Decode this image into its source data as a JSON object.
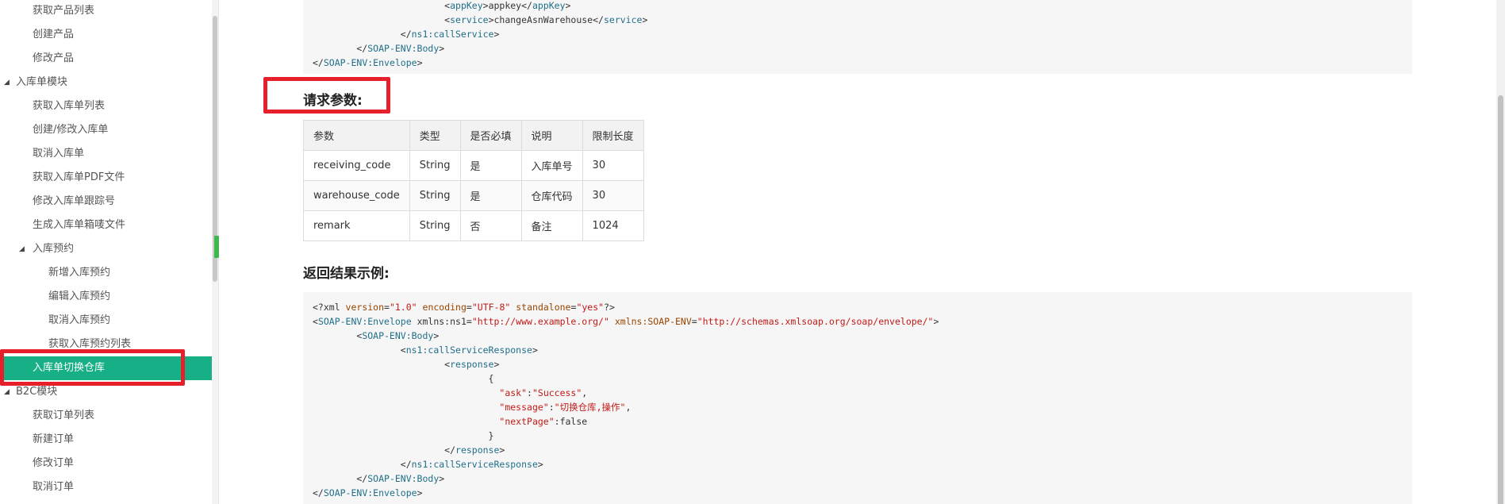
{
  "sidebar": {
    "items": [
      {
        "label": "获取产品列表",
        "level": 2
      },
      {
        "label": "创建产品",
        "level": 2
      },
      {
        "label": "修改产品",
        "level": 2
      },
      {
        "label": "入库单模块",
        "level": 1,
        "expanded": true
      },
      {
        "label": "获取入库单列表",
        "level": 2
      },
      {
        "label": "创建/修改入库单",
        "level": 2
      },
      {
        "label": "取消入库单",
        "level": 2
      },
      {
        "label": "获取入库单PDF文件",
        "level": 2
      },
      {
        "label": "修改入库单跟踪号",
        "level": 2
      },
      {
        "label": "生成入库单箱唛文件",
        "level": 2
      },
      {
        "label": "入库预约",
        "level": 2,
        "expanded": true
      },
      {
        "label": "新增入库预约",
        "level": 3
      },
      {
        "label": "编辑入库预约",
        "level": 3
      },
      {
        "label": "取消入库预约",
        "level": 3
      },
      {
        "label": "获取入库预约列表",
        "level": 3
      },
      {
        "label": "入库单切换仓库",
        "level": 2,
        "active": true
      },
      {
        "label": "B2C模块",
        "level": 1,
        "expanded": true
      },
      {
        "label": "获取订单列表",
        "level": 2
      },
      {
        "label": "新建订单",
        "level": 2
      },
      {
        "label": "修改订单",
        "level": 2
      },
      {
        "label": "取消订单",
        "level": 2
      }
    ],
    "collapse_icon": "chevron-left-icon"
  },
  "top_code": {
    "lines": [
      {
        "indent": 4,
        "text": "<appKey>appkey</appKey>"
      },
      {
        "indent": 4,
        "text": "<service>changeAsnWarehouse</service>"
      },
      {
        "indent": 3,
        "text": "</ns1:callService>"
      },
      {
        "indent": 2,
        "text": "</SOAP-ENV:Body>"
      },
      {
        "indent": 1,
        "text": "</SOAP-ENV:Envelope>"
      }
    ]
  },
  "request_params": {
    "title": "请求参数:",
    "headers": [
      "参数",
      "类型",
      "是否必填",
      "说明",
      "限制长度"
    ],
    "rows": [
      [
        "receiving_code",
        "String",
        "是",
        "入库单号",
        "30"
      ],
      [
        "warehouse_code",
        "String",
        "是",
        "仓库代码",
        "30"
      ],
      [
        "remark",
        "String",
        "否",
        "备注",
        "1024"
      ]
    ]
  },
  "response_example": {
    "title": "返回结果示例:",
    "lines": [
      "<?xml version=\"1.0\" encoding=\"UTF-8\" standalone=\"yes\"?>",
      "<SOAP-ENV:Envelope xmlns:ns1=\"http://www.example.org/\" xmlns:SOAP-ENV=\"http://schemas.xmlsoap.org/soap/envelope/\">",
      "        <SOAP-ENV:Body>",
      "                <ns1:callServiceResponse>",
      "                        <response>",
      "                                {",
      "                                  \"ask\":\"Success\",",
      "                                  \"message\":\"切换仓库,操作\",",
      "                                  \"nextPage\":false",
      "                                }",
      "                        </response>",
      "                </ns1:callServiceResponse>",
      "        </SOAP-ENV:Body>",
      "</SOAP-ENV:Envelope>"
    ]
  },
  "colors": {
    "active_bg": "#17b086",
    "highlight": "#e5202b",
    "toggle": "#3fb94e"
  }
}
